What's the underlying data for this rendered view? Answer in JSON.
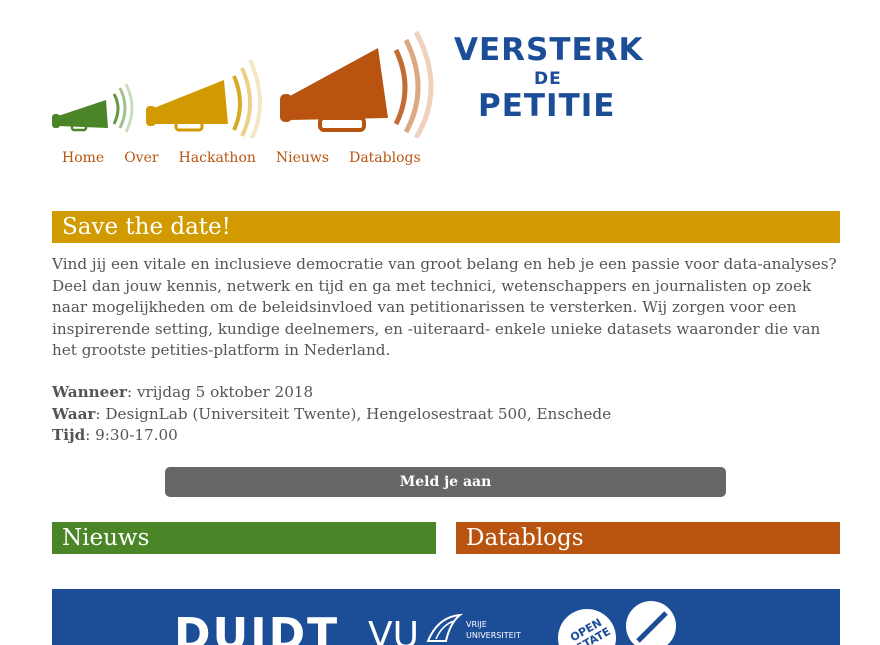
{
  "logo": {
    "line1": "VERSTERK",
    "line2": "DE",
    "line3": "PETITIE",
    "colors": {
      "green": "#4a8527",
      "yellow": "#d19a00",
      "orange": "#b85410",
      "blue": "#1c4d97"
    }
  },
  "nav": {
    "items": [
      {
        "label": "Home"
      },
      {
        "label": "Over"
      },
      {
        "label": "Hackathon"
      },
      {
        "label": "Nieuws"
      },
      {
        "label": "Datablogs"
      }
    ]
  },
  "save_the_date": {
    "title": "Save the date!",
    "intro": "Vind jij een vitale en inclusieve democratie van groot belang en heb je een passie voor data-analyses? Deel dan jouw kennis, netwerk en tijd en ga met technici, wetenschappers en journalisten op zoek naar mogelijkheden om de beleidsinvloed van petitionarissen te versterken. Wij zorgen voor een inspirerende setting, kundige deelnemers, en -uiteraard- enkele unieke datasets waaronder die van het grootste petities-platform in Nederland.",
    "when_label": "Wanneer",
    "when_value": ": vrijdag 5 oktober 2018",
    "where_label": "Waar",
    "where_value": ": DesignLab (Universiteit Twente), Hengelosestraat 500, Enschede",
    "time_label": "Tijd",
    "time_value": ": 9:30-17.00"
  },
  "cta": {
    "label": "Meld je aan"
  },
  "sections": {
    "news_title": "Nieuws",
    "datablogs_title": "Datablogs"
  },
  "partners": {
    "duidt": "DUIDT",
    "vu": "VU",
    "vu_line1": "VRIJE",
    "vu_line2": "UNIVERSITEIT",
    "od_line1": "OPEN",
    "od_line2": "STATE"
  }
}
